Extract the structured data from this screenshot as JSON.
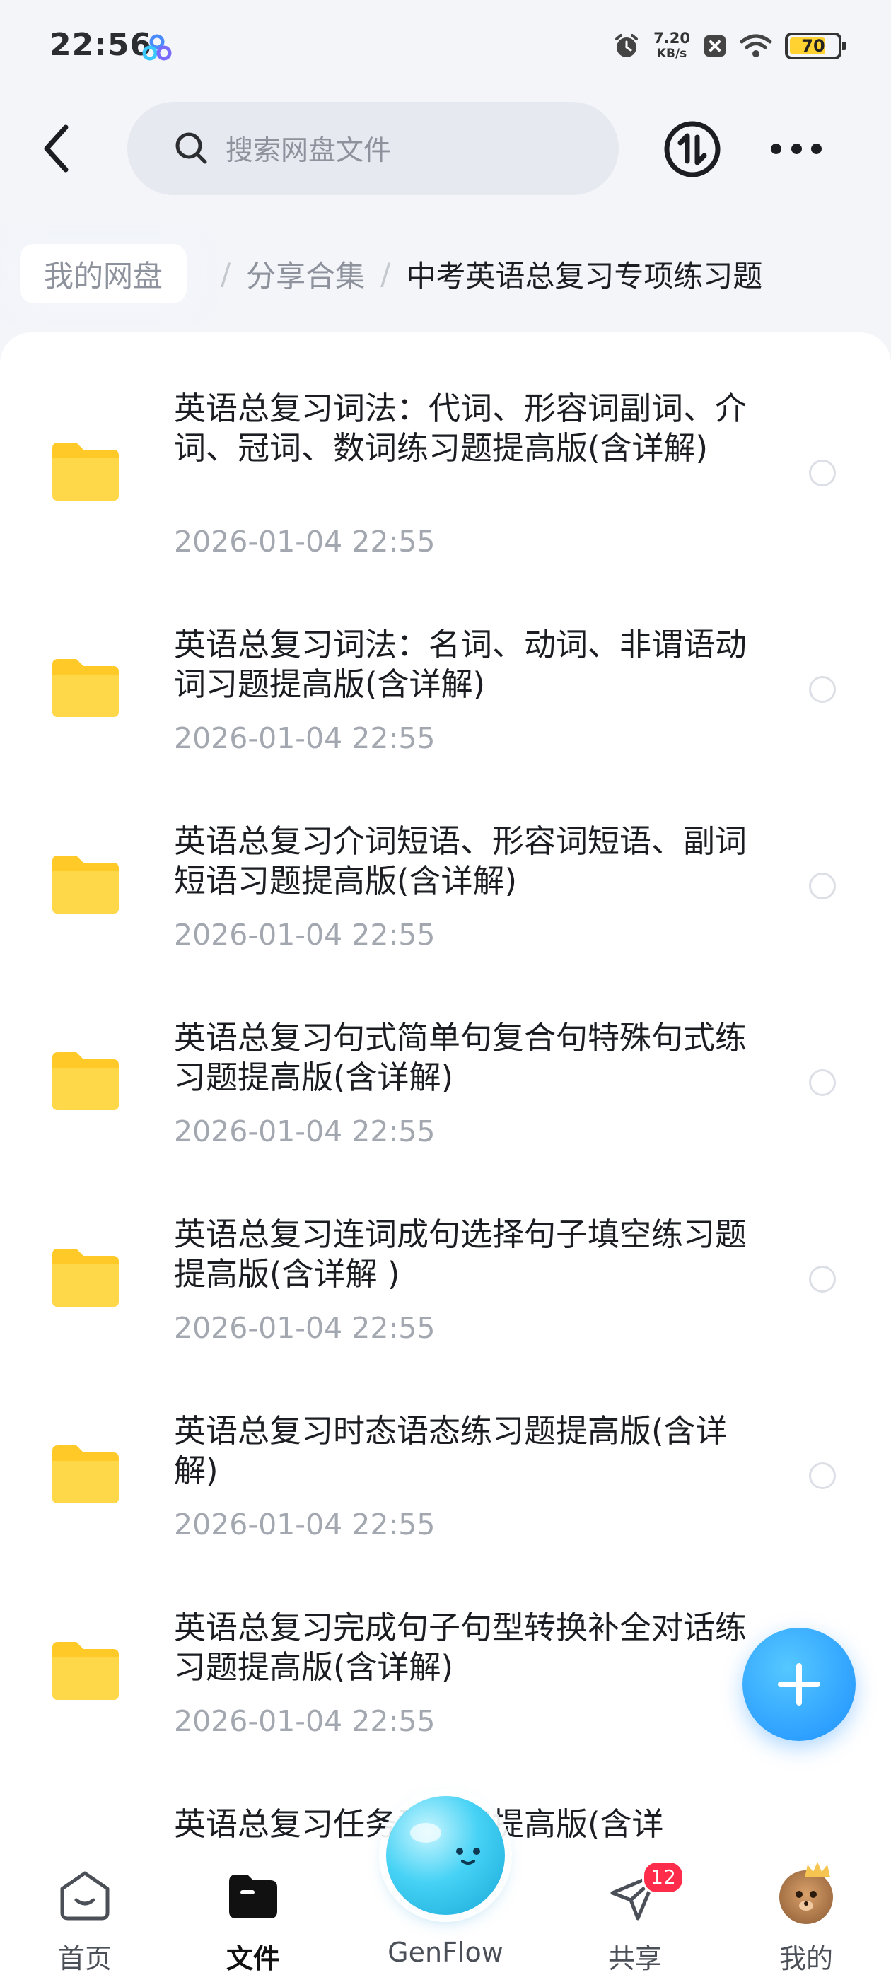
{
  "status_bar": {
    "time": "22:56",
    "net_speed_value": "7.20",
    "net_speed_unit": "KB/s",
    "battery": "70"
  },
  "header": {
    "search_placeholder": "搜索网盘文件"
  },
  "breadcrumb": {
    "root": "我的网盘",
    "middle": "分享合集",
    "current": "中考英语总复习专项练习题"
  },
  "files": [
    {
      "title": "英语总复习词法：代词、形容词副词、介词、冠词、数词练习题提高版(含详解)",
      "date": "2026-01-04  22:55"
    },
    {
      "title": "英语总复习词法：名词、动词、非谓语动词习题提高版(含详解)",
      "date": "2026-01-04  22:55"
    },
    {
      "title": "英语总复习介词短语、形容词短语、副词短语习题提高版(含详解)",
      "date": "2026-01-04  22:55"
    },
    {
      "title": "英语总复习句式简单句复合句特殊句式练习题提高版(含详解)",
      "date": "2026-01-04  22:55"
    },
    {
      "title": "英语总复习连词成句选择句子填空练习题提高版(含详解 )",
      "date": "2026-01-04  22:55"
    },
    {
      "title": "英语总复习时态语态练习题提高版(含详解)",
      "date": "2026-01-04  22:55"
    },
    {
      "title": "英语总复习完成句子句型转换补全对话练习题提高版(含详解)",
      "date": "2026-01-04  22:55"
    },
    {
      "title": "英语总复习任务型阅读提高版(含详",
      "date": ""
    }
  ],
  "tabs": {
    "home": "首页",
    "files": "文件",
    "genflow": "GenFlow",
    "share": "共享",
    "share_badge": "12",
    "mine": "我的"
  },
  "colors": {
    "accent": "#1e90ff",
    "folder": "#ffc928",
    "badge": "#ff2d4b"
  }
}
